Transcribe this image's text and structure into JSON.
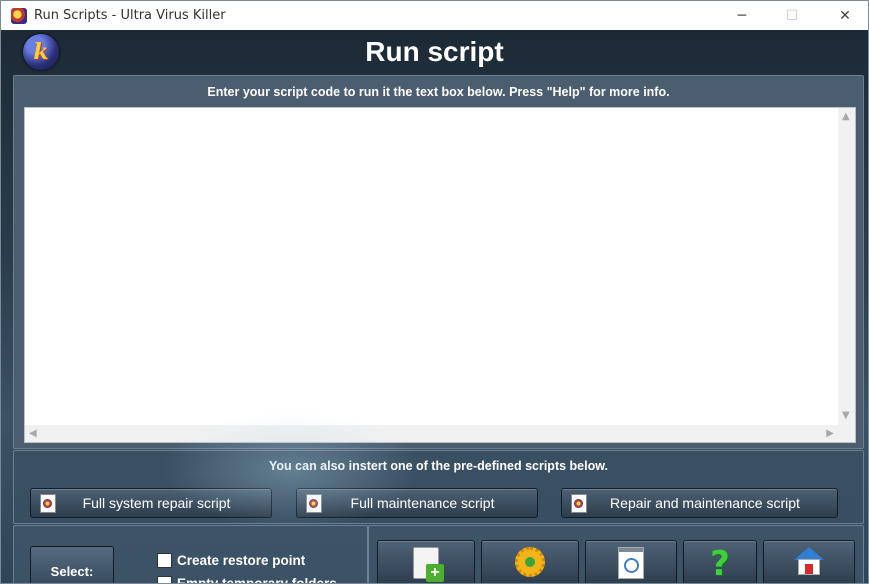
{
  "window": {
    "title": "Run Scripts - Ultra Virus Killer",
    "controls": {
      "minimize": "─",
      "maximize": "☐",
      "close": "✕"
    }
  },
  "header": {
    "logo_text": "k",
    "title": "Run script"
  },
  "editor": {
    "instruction": "Enter your script code to run it the text box below. Press \"Help\" for more info.",
    "value": "",
    "scroll_up": "▲",
    "scroll_down": "▼",
    "scroll_left": "◀",
    "scroll_right": "▶"
  },
  "predefined": {
    "label": "You can also instert one of the pre-defined scripts below.",
    "buttons": [
      {
        "label": "Full system repair script"
      },
      {
        "label": "Full maintenance script"
      },
      {
        "label": "Repair and maintenance script"
      }
    ]
  },
  "options": {
    "select_label": "Select:",
    "checkboxes": [
      {
        "label": "Create restore point",
        "checked": false
      },
      {
        "label": "Empty temporary folders",
        "checked": false
      }
    ]
  },
  "actions": {
    "icons": [
      "new-document-icon",
      "run-gear-icon",
      "search-notepad-icon",
      "help-icon",
      "home-icon"
    ],
    "help_glyph": "?",
    "new_glyph": "+"
  },
  "colors": {
    "accent_green": "#4caf2f",
    "help_green": "#3cd13c",
    "gear_orange": "#f2b418",
    "home_blue": "#2f7fd6",
    "home_red": "#d62b2b"
  }
}
